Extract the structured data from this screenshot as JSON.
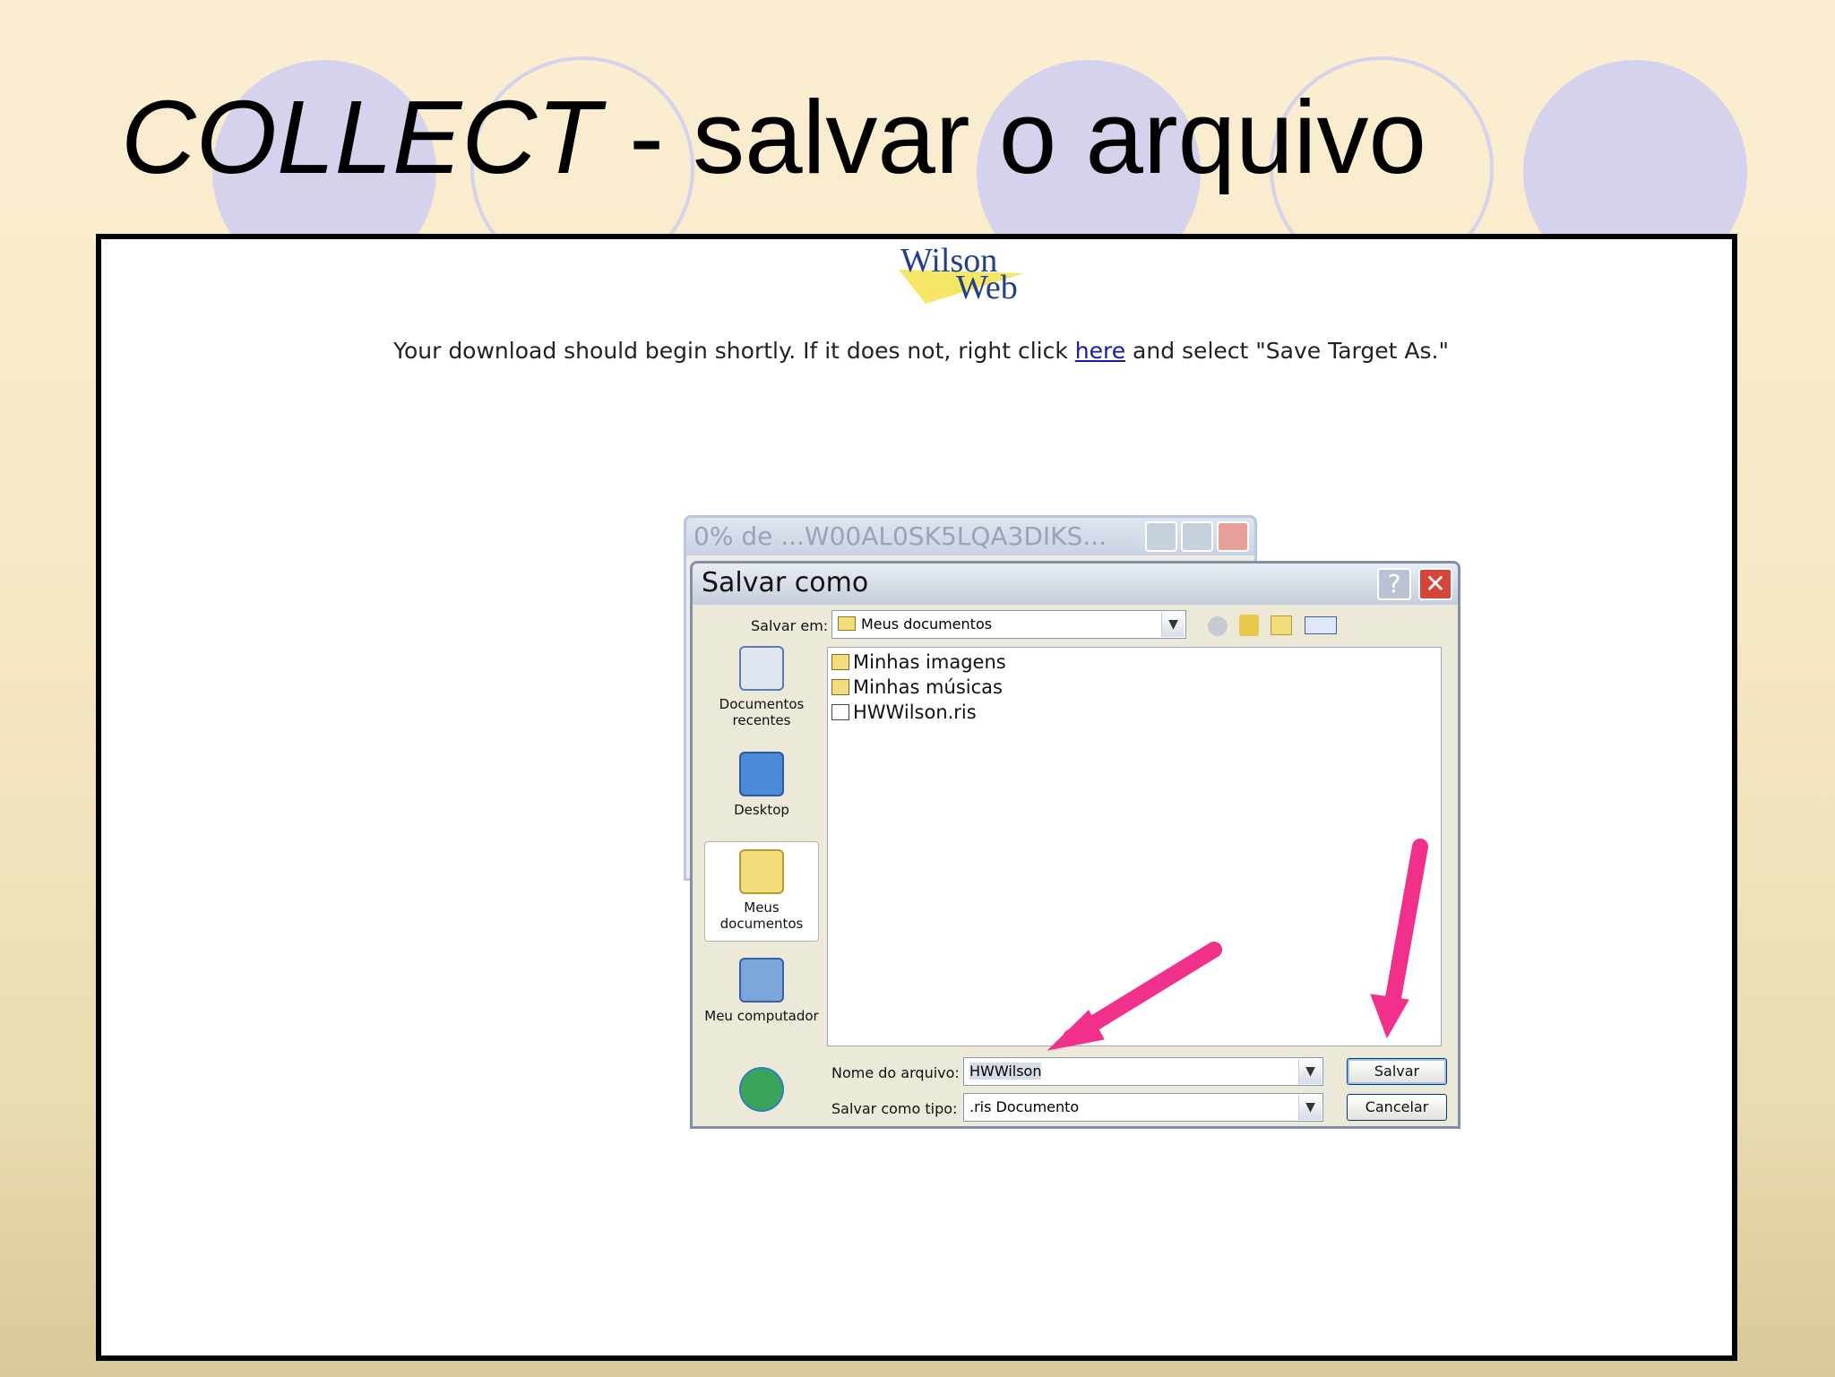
{
  "slide": {
    "title_em": "COLLECT",
    "title_rest": " - salvar o arquivo"
  },
  "page": {
    "logo_line1": "Wilson",
    "logo_line2": "Web",
    "notice_before": "Your download should begin shortly. If it does not, right click ",
    "notice_link": "here",
    "notice_after": " and select \"Save Target As.\""
  },
  "download_window": {
    "title": "0% de ...W00AL0SK5LQA3DIKS..."
  },
  "dialog": {
    "title": "Salvar como",
    "help_label": "?",
    "close_label": "✕",
    "save_in_label": "Salvar em:",
    "save_in_value": "Meus documentos",
    "places": [
      {
        "label": "Documentos\nrecentes",
        "icon": "recent-documents-icon"
      },
      {
        "label": "Desktop",
        "icon": "desktop-icon"
      },
      {
        "label": "Meus\ndocumentos",
        "icon": "my-documents-icon"
      },
      {
        "label": "Meu computador",
        "icon": "my-computer-icon"
      },
      {
        "label": "",
        "icon": "network-places-icon"
      }
    ],
    "files": [
      {
        "name": "Minhas imagens",
        "icon": "folder-icon"
      },
      {
        "name": "Minhas músicas",
        "icon": "folder-icon"
      },
      {
        "name": "HWWilson.ris",
        "icon": "document-icon"
      }
    ],
    "filename_label": "Nome do arquivo:",
    "filename_value": "HWWilson",
    "filetype_label": "Salvar como tipo:",
    "filetype_value": ".ris Documento",
    "save_button": "Salvar",
    "cancel_button": "Cancelar"
  },
  "colors": {
    "arrow": "#f0308a",
    "circle": "#d4d2ec",
    "link": "#1a1aa6"
  }
}
